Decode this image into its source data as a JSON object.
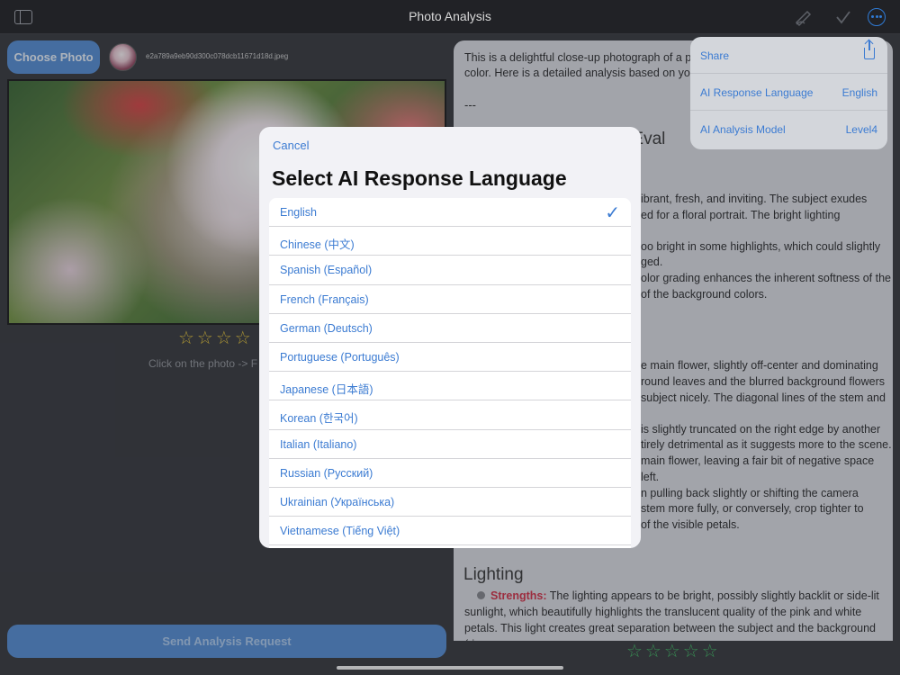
{
  "header": {
    "title": "Photo Analysis"
  },
  "left": {
    "choose_label": "Choose Photo",
    "filename": "e2a789a9eb90d300c078dcb11671d18d.jpeg",
    "hint": "Click on the photo -> F",
    "rating_stars": "☆☆☆☆",
    "send_label": "Send Analysis Request"
  },
  "analysis": {
    "intro1": "This is a delightful close-up photograph of a pe",
    "intro2": "color. Here is a detailed analysis based on your",
    "separator": "---",
    "heading_partial": "nd Eval",
    "lines": [
      "ibrant, fresh, and inviting. The subject exudes",
      "ed for a floral portrait. The bright lighting",
      "oo bright in some highlights, which could slightly",
      "ged.",
      "olor grading enhances the inherent softness of the",
      "of the background colors.",
      "e main flower, slightly off-center and dominating",
      "round leaves and the blurred background flowers",
      "subject nicely. The diagonal lines of the stem and",
      "is slightly truncated on the right edge by another",
      "tirely detrimental as it suggests more to the scene.",
      "main flower, leaving a fair bit of negative space",
      "left.",
      "n pulling back slightly or shifting the camera",
      "stem more fully, or conversely, crop tighter to",
      "of the visible petals."
    ],
    "lighting_heading": "Lighting",
    "strengths_label": "Strengths:",
    "lighting_line1": " The lighting appears to be bright, possibly slightly backlit or side-lit",
    "lighting_line2": "sunlight, which beautifully highlights the translucent quality of the pink and white",
    "lighting_line3": "petals. This light creates great separation between the subject and the background (rim",
    "rating_stars": "☆☆☆☆☆"
  },
  "modal": {
    "cancel_label": "Cancel",
    "title": "Select AI Response Language",
    "selected": "English",
    "languages": [
      "English",
      "Chinese (中文)",
      "Spanish (Español)",
      "French (Français)",
      "German (Deutsch)",
      "Portuguese (Português)",
      "Japanese (日本語)",
      "Korean (한국어)",
      "Italian (Italiano)",
      "Russian (Русский)",
      "Ukrainian (Українська)",
      "Vietnamese (Tiếng Việt)"
    ],
    "check_mark": "✓"
  },
  "menu": {
    "share_label": "Share",
    "language_label": "AI Response Language",
    "language_value": "English",
    "model_label": "AI Analysis Model",
    "model_value": "Level4"
  },
  "colors": {
    "accent": "#3b7bd2",
    "button": "#4a86d1",
    "star_yellow": "#e7c22b",
    "star_green": "#35b85a",
    "strength_red": "#d0243c"
  },
  "icons": [
    "sidebar-icon",
    "pencil-icon",
    "checkmark-icon",
    "more-icon",
    "share-icon",
    "check-icon"
  ]
}
